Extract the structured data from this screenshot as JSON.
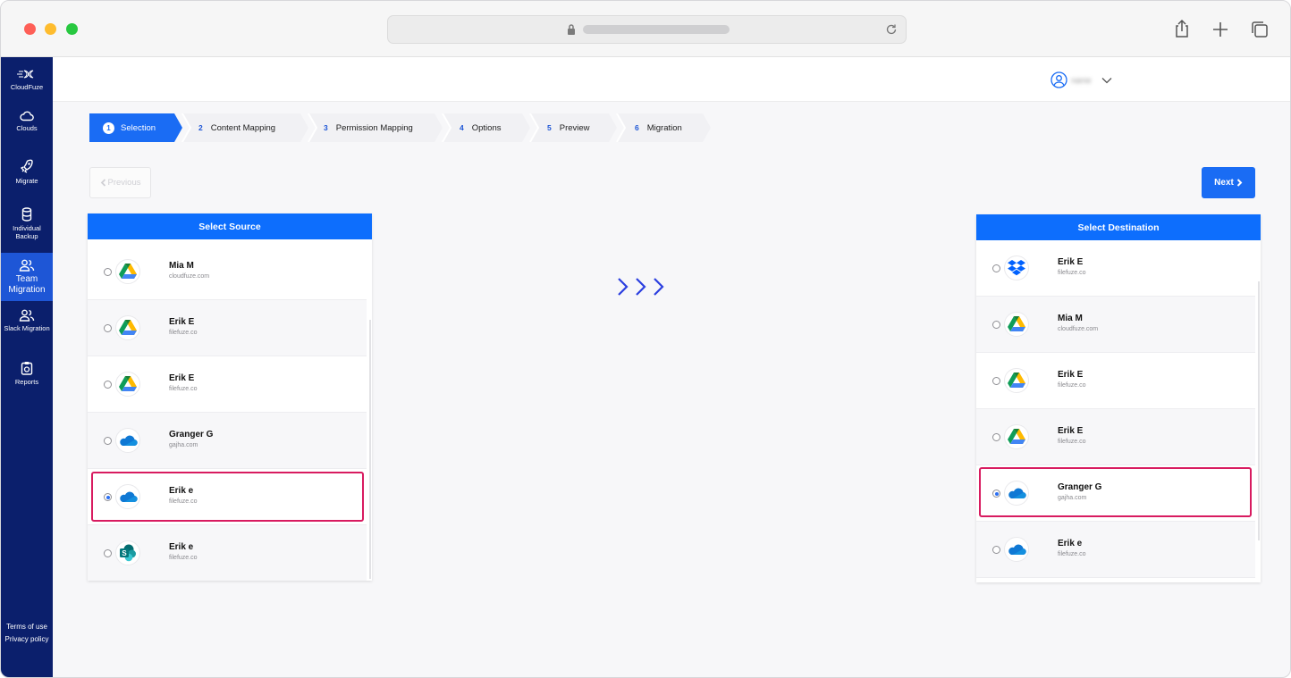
{
  "app": {
    "brand": "CloudFuze"
  },
  "sidebar": {
    "items": [
      {
        "label": "Clouds",
        "icon": "cloud-icon"
      },
      {
        "label": "Migrate",
        "icon": "rocket-icon"
      },
      {
        "label": "Individual Backup",
        "icon": "database-icon"
      },
      {
        "label": "Team Migration",
        "icon": "team-icon",
        "active": true
      },
      {
        "label": "Slack Migration",
        "icon": "team-icon"
      },
      {
        "label": "Reports",
        "icon": "report-icon"
      }
    ],
    "footer": {
      "terms": "Terms of use",
      "privacy": "Privacy policy"
    }
  },
  "header": {
    "user_name": "name"
  },
  "steps": [
    {
      "num": "1",
      "label": "Selection",
      "active": true
    },
    {
      "num": "2",
      "label": "Content Mapping"
    },
    {
      "num": "3",
      "label": "Permission Mapping"
    },
    {
      "num": "4",
      "label": "Options"
    },
    {
      "num": "5",
      "label": "Preview"
    },
    {
      "num": "6",
      "label": "Migration"
    }
  ],
  "buttons": {
    "previous": "Previous",
    "next": "Next"
  },
  "source": {
    "title": "Select Source",
    "rows": [
      {
        "name": "Mia M",
        "domain": "cloudfuze.com",
        "service": "google-drive",
        "selected": false
      },
      {
        "name": "Erik E",
        "domain": "filefuze.co",
        "service": "google-drive",
        "selected": false
      },
      {
        "name": "Erik E",
        "domain": "filefuze.co",
        "service": "google-drive",
        "selected": false
      },
      {
        "name": "Granger G",
        "domain": "gajha.com",
        "service": "onedrive",
        "selected": false
      },
      {
        "name": "Erik e",
        "domain": "filefuze.co",
        "service": "onedrive",
        "selected": true
      },
      {
        "name": "Erik e",
        "domain": "filefuze.co",
        "service": "sharepoint",
        "selected": false
      }
    ]
  },
  "destination": {
    "title": "Select Destination",
    "rows": [
      {
        "name": "Erik E",
        "domain": "filefuze.co",
        "service": "dropbox",
        "selected": false
      },
      {
        "name": "Mia M",
        "domain": "cloudfuze.com",
        "service": "google-drive",
        "selected": false
      },
      {
        "name": "Erik E",
        "domain": "filefuze.co",
        "service": "google-drive",
        "selected": false
      },
      {
        "name": "Erik E",
        "domain": "filefuze.co",
        "service": "google-drive",
        "selected": false
      },
      {
        "name": "Granger G",
        "domain": "gajha.com",
        "service": "onedrive",
        "selected": true
      },
      {
        "name": "Erik e",
        "domain": "filefuze.co",
        "service": "onedrive",
        "selected": false
      }
    ]
  },
  "colors": {
    "sidebar": "#0b1f6c",
    "accent": "#0d6efd",
    "highlight": "#d81b60"
  }
}
